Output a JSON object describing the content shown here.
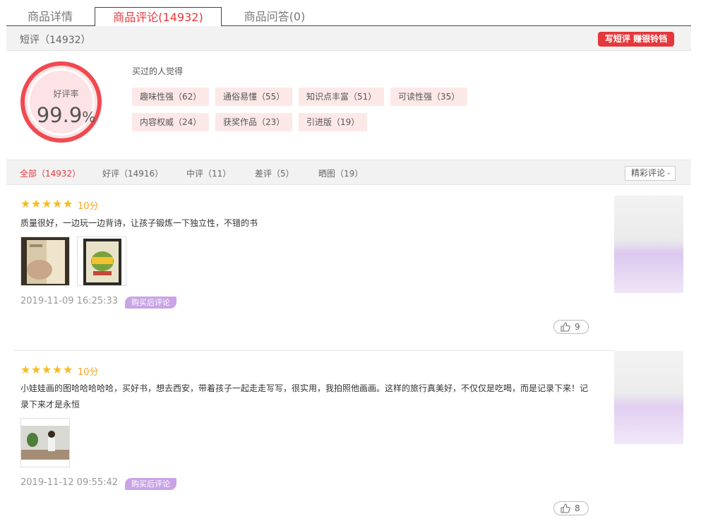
{
  "tabs": [
    {
      "label": "商品详情"
    },
    {
      "label": "商品评论(14932)"
    },
    {
      "label": "商品问答(0)"
    }
  ],
  "short_review": {
    "label": "短评（14932）",
    "write_button": "写短评 赚银铃铛"
  },
  "rating": {
    "label": "好评率",
    "value": "99.9",
    "unit": "%"
  },
  "tags_title": "买过的人觉得",
  "tags": [
    {
      "label": "趣味性强（62）"
    },
    {
      "label": "通俗易懂（55）"
    },
    {
      "label": "知识点丰富（51）"
    },
    {
      "label": "可读性强（35）"
    },
    {
      "label": "内容权威（24）"
    },
    {
      "label": "获奖作品（23）"
    },
    {
      "label": "引进版（19）"
    }
  ],
  "filters": [
    {
      "label": "全部（14932）"
    },
    {
      "label": "好评（14916）"
    },
    {
      "label": "中评（11）"
    },
    {
      "label": "差评（5）"
    },
    {
      "label": "晒图（19）"
    }
  ],
  "sort": {
    "selected": "精彩评论"
  },
  "reviews": [
    {
      "stars": 5,
      "score": "10分",
      "content": "质量很好，一边玩一边背诗，让孩子锻炼一下独立性，不错的书",
      "date": "2019-11-09 16:25:33",
      "badge": "购买后评论",
      "likes": "9"
    },
    {
      "stars": 5,
      "score": "10分",
      "content": "小娃娃画的图哈哈哈哈哈，买好书，想去西安，带着孩子一起走走写写，很实用，我拍照他画画。这样的旅行真美好，不仅仅是吃喝，而是记录下来！记录下来才是永恒",
      "date": "2019-11-12 09:55:42",
      "badge": "购买后评论",
      "likes": "8"
    }
  ],
  "colors": {
    "accent": "#e4393c",
    "star": "#fbba18",
    "badge": "#c9a3e6",
    "tag_bg": "#fde8e8"
  }
}
